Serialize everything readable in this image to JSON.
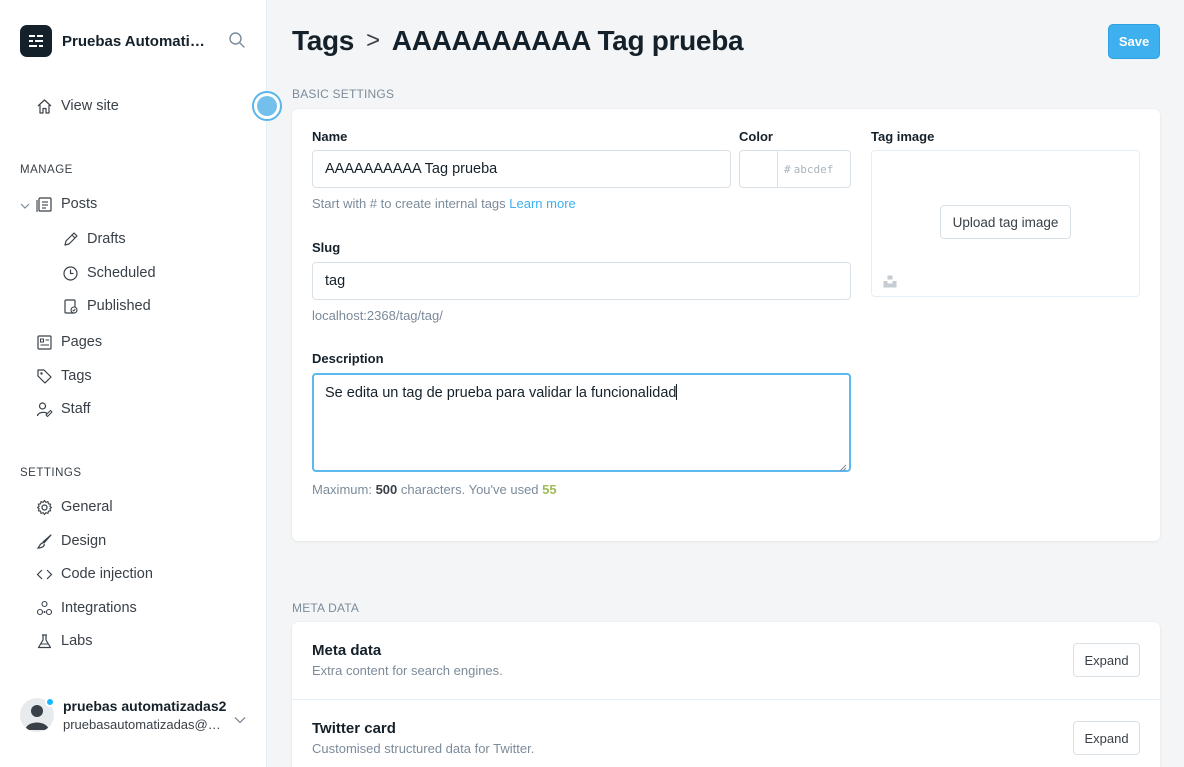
{
  "sidebar": {
    "site_title": "Pruebas Automatizadas",
    "view_site": "View site",
    "manage_label": "MANAGE",
    "settings_label": "SETTINGS",
    "manage_items": {
      "posts": "Posts",
      "drafts": "Drafts",
      "scheduled": "Scheduled",
      "published": "Published",
      "pages": "Pages",
      "tags": "Tags",
      "staff": "Staff"
    },
    "settings_items": {
      "general": "General",
      "design": "Design",
      "code_injection": "Code injection",
      "integrations": "Integrations",
      "labs": "Labs"
    },
    "user": {
      "name": "pruebas automatizadas2",
      "email": "pruebasautomatizadas@uniandes.edu.co"
    }
  },
  "header": {
    "breadcrumb_parent": "Tags",
    "breadcrumb_separator": ">",
    "title": "AAAAAAAAAA Tag prueba",
    "save_label": "Save"
  },
  "basic": {
    "section_label": "BASIC SETTINGS",
    "name_label": "Name",
    "name_value": "AAAAAAAAAA Tag prueba",
    "name_hint": "Start with # to create internal tags",
    "learn_more": "Learn more",
    "color_label": "Color",
    "color_hash": "#",
    "color_placeholder": "abcdef",
    "image_label": "Tag image",
    "upload_label": "Upload tag image",
    "slug_label": "Slug",
    "slug_value": "tag",
    "slug_url": "localhost:2368/tag/tag/",
    "description_label": "Description",
    "description_value": "Se edita un tag de prueba para validar la funcionalidad",
    "counter_prefix": "Maximum:",
    "counter_max": "500",
    "counter_middle": "characters. You've used",
    "counter_used": "55"
  },
  "meta": {
    "section_label": "META DATA",
    "rows": [
      {
        "title": "Meta data",
        "desc": "Extra content for search engines.",
        "button": "Expand"
      },
      {
        "title": "Twitter card",
        "desc": "Customised structured data for Twitter.",
        "button": "Expand"
      }
    ]
  },
  "colors": {
    "accent": "#3eb0ef",
    "counter_used": "#9fbb58",
    "text_dark": "#15212a",
    "muted": "#7c8b9a"
  },
  "icons": [
    "ghost-logo-icon",
    "search-icon",
    "home-icon",
    "posts-icon",
    "pencil-icon",
    "clock-icon",
    "published-icon",
    "pages-icon",
    "tag-icon",
    "staff-icon",
    "gear-icon",
    "design-brush-icon",
    "code-icon",
    "integrations-icon",
    "labs-flask-icon",
    "chevron-down-icon",
    "unsplash-icon"
  ]
}
